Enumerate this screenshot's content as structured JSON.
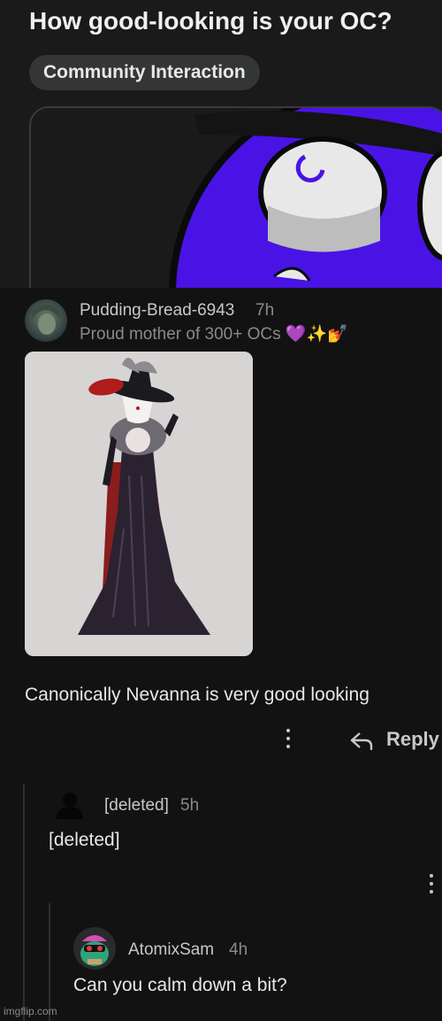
{
  "post": {
    "title": "How good-looking is your OC?",
    "flair": "Community Interaction"
  },
  "comments": [
    {
      "username": "Pudding-Bread-6943",
      "age": "7h",
      "user_flair": "Proud mother of 300+ OCs 💜✨💅",
      "body": "Canonically Nevanna is very good looking",
      "reply_label": "Reply"
    },
    {
      "username": "[deleted]",
      "age": "5h",
      "body": "[deleted]"
    },
    {
      "username": "AtomixSam",
      "age": "4h",
      "body": "Can you calm down a bit?"
    }
  ],
  "watermark": "imgflip.com",
  "colors": {
    "background": "#121212",
    "panel": "#1a1a1b",
    "post_art_purple": "#4a13e6",
    "dress": "#2a2230"
  },
  "icons": [
    "more-options-icon",
    "reply-arrow-icon",
    "deleted-user-icon"
  ]
}
